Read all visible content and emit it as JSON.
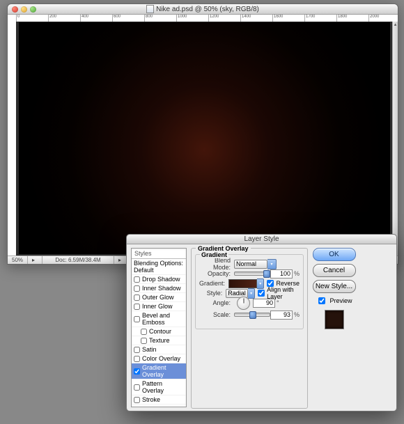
{
  "window": {
    "title": "Nike ad.psd @ 50% (sky, RGB/8)",
    "zoom": "50%",
    "doc_info": "Doc: 6.59M/38.4M",
    "ruler_vals": [
      "0",
      "200",
      "400",
      "600",
      "800",
      "1000",
      "1200",
      "1400",
      "1600",
      "1700",
      "1800",
      "2000"
    ]
  },
  "dialog": {
    "title": "Layer Style",
    "styles_header": "Styles",
    "blend_default": "Blending Options: Default",
    "styles": [
      {
        "k": "drop_shadow",
        "label": "Drop Shadow",
        "on": false
      },
      {
        "k": "inner_shadow",
        "label": "Inner Shadow",
        "on": false
      },
      {
        "k": "outer_glow",
        "label": "Outer Glow",
        "on": false
      },
      {
        "k": "inner_glow",
        "label": "Inner Glow",
        "on": false
      },
      {
        "k": "bevel",
        "label": "Bevel and Emboss",
        "on": false
      },
      {
        "k": "contour",
        "label": "Contour",
        "on": false,
        "sub": true
      },
      {
        "k": "texture",
        "label": "Texture",
        "on": false,
        "sub": true
      },
      {
        "k": "satin",
        "label": "Satin",
        "on": false
      },
      {
        "k": "color_ov",
        "label": "Color Overlay",
        "on": false
      },
      {
        "k": "grad_ov",
        "label": "Gradient Overlay",
        "on": true,
        "sel": true
      },
      {
        "k": "pat_ov",
        "label": "Pattern Overlay",
        "on": false
      },
      {
        "k": "stroke",
        "label": "Stroke",
        "on": false
      }
    ],
    "section_title": "Gradient Overlay",
    "group_title": "Gradient",
    "labels": {
      "blend": "Blend Mode:",
      "opacity": "Opacity:",
      "gradient": "Gradient:",
      "style": "Style:",
      "angle": "Angle:",
      "scale": "Scale:"
    },
    "blend_mode": "Normal",
    "opacity": "100",
    "reverse_label": "Reverse",
    "reverse": true,
    "style": "Radial",
    "align_label": "Align with Layer",
    "align": true,
    "angle": "90",
    "scale": "93",
    "buttons": {
      "ok": "OK",
      "cancel": "Cancel",
      "new_style": "New Style..."
    },
    "preview_label": "Preview",
    "preview": true
  },
  "chart_data": null
}
